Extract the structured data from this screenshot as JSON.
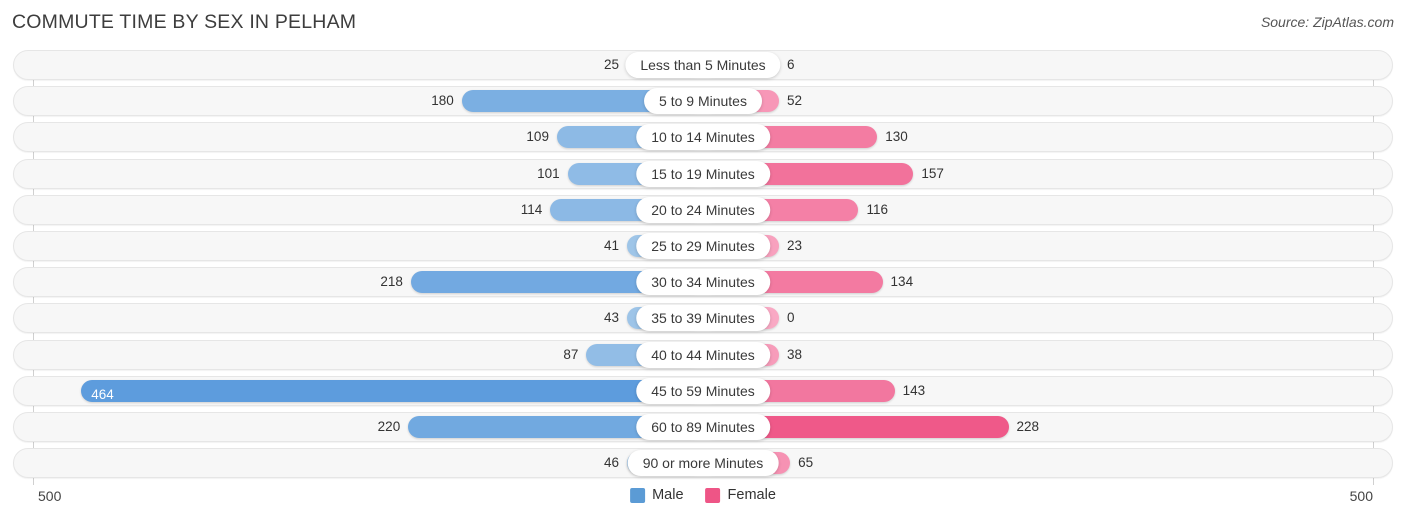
{
  "header": {
    "title": "COMMUTE TIME BY SEX IN PELHAM",
    "source": "Source: ZipAtlas.com"
  },
  "footer": {
    "axis_max_left": "500",
    "axis_max_right": "500"
  },
  "legend": {
    "items": [
      {
        "label": "Male",
        "color": "#5b9bd5"
      },
      {
        "label": "Female",
        "color": "#ee5586"
      }
    ]
  },
  "chart_data": {
    "type": "bar",
    "subtype": "diverging-bar",
    "title": "COMMUTE TIME BY SEX IN PELHAM",
    "xlabel": "",
    "ylabel": "",
    "axis_max": 500,
    "xlim": [
      -500,
      500
    ],
    "grid": false,
    "legend_position": "bottom-center",
    "categories": [
      "Less than 5 Minutes",
      "5 to 9 Minutes",
      "10 to 14 Minutes",
      "15 to 19 Minutes",
      "20 to 24 Minutes",
      "25 to 29 Minutes",
      "30 to 34 Minutes",
      "35 to 39 Minutes",
      "40 to 44 Minutes",
      "45 to 59 Minutes",
      "60 to 89 Minutes",
      "90 or more Minutes"
    ],
    "series": [
      {
        "name": "Male",
        "side": "left",
        "color": "#5b9bd5",
        "values": [
          25,
          180,
          109,
          101,
          114,
          41,
          218,
          43,
          87,
          464,
          220,
          46
        ]
      },
      {
        "name": "Female",
        "side": "right",
        "color": "#ee5586",
        "values": [
          6,
          52,
          130,
          157,
          116,
          23,
          134,
          0,
          38,
          143,
          228,
          65
        ]
      }
    ],
    "rows": [
      {
        "category": "Less than 5 Minutes",
        "male": "25",
        "female": "6",
        "male_value": 25,
        "female_value": 6
      },
      {
        "category": "5 to 9 Minutes",
        "male": "180",
        "female": "52",
        "male_value": 180,
        "female_value": 52
      },
      {
        "category": "10 to 14 Minutes",
        "male": "109",
        "female": "130",
        "male_value": 109,
        "female_value": 130
      },
      {
        "category": "15 to 19 Minutes",
        "male": "101",
        "female": "157",
        "male_value": 101,
        "female_value": 157
      },
      {
        "category": "20 to 24 Minutes",
        "male": "114",
        "female": "116",
        "male_value": 114,
        "female_value": 116
      },
      {
        "category": "25 to 29 Minutes",
        "male": "41",
        "female": "23",
        "male_value": 41,
        "female_value": 23
      },
      {
        "category": "30 to 34 Minutes",
        "male": "218",
        "female": "134",
        "male_value": 218,
        "female_value": 134
      },
      {
        "category": "35 to 39 Minutes",
        "male": "43",
        "female": "0",
        "male_value": 43,
        "female_value": 0
      },
      {
        "category": "40 to 44 Minutes",
        "male": "87",
        "female": "38",
        "male_value": 87,
        "female_value": 38
      },
      {
        "category": "45 to 59 Minutes",
        "male": "464",
        "female": "143",
        "male_value": 464,
        "female_value": 143
      },
      {
        "category": "60 to 89 Minutes",
        "male": "220",
        "female": "228",
        "male_value": 220,
        "female_value": 228
      },
      {
        "category": "90 or more Minutes",
        "male": "46",
        "female": "65",
        "male_value": 46,
        "female_value": 65
      }
    ]
  }
}
